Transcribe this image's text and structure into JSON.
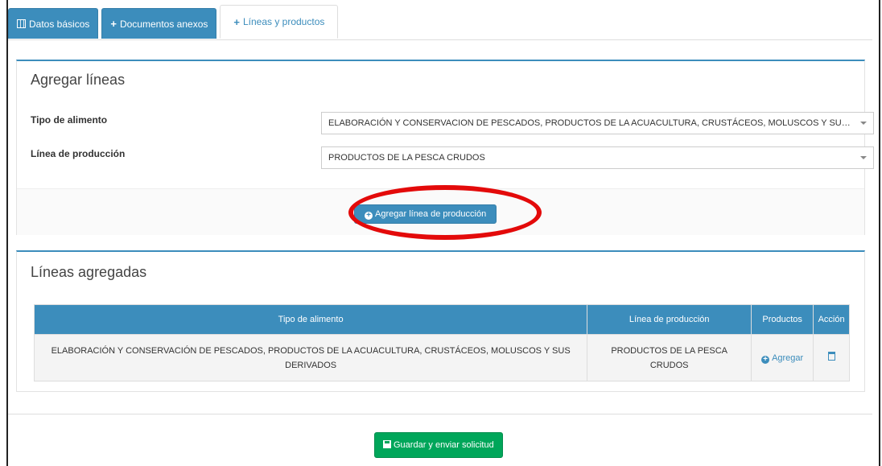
{
  "tabs": [
    {
      "label": "Datos básicos",
      "icon": "calendar-icon",
      "active": false
    },
    {
      "label": "Documentos anexos",
      "icon": "plus-icon",
      "active": false
    },
    {
      "label": "Líneas y productos",
      "icon": "plus-icon",
      "active": true
    }
  ],
  "agregar": {
    "title": "Agregar líneas",
    "tipo_label": "Tipo de alimento",
    "tipo_value": "ELABORACIÓN Y CONSERVACION DE PESCADOS, PRODUCTOS DE LA ACUACULTURA, CRUSTÁCEOS, MOLUSCOS Y SUS DERIVADOS",
    "linea_label": "Línea de producción",
    "linea_value": "PRODUCTOS DE LA PESCA CRUDOS",
    "add_button": "Agregar línea de producción"
  },
  "agregadas": {
    "title": "Líneas agregadas",
    "columns": [
      "Tipo de alimento",
      "Línea de producción",
      "Productos",
      "Acción"
    ],
    "rows": [
      {
        "tipo": "ELABORACIÓN Y CONSERVACIÓN DE PESCADOS, PRODUCTOS DE LA ACUACULTURA, CRUSTÁCEOS, MOLUSCOS Y SUS DERIVADOS",
        "linea": "PRODUCTOS DE LA PESCA CRUDOS",
        "productos": "Agregar",
        "accion_icon": "trash-icon"
      }
    ]
  },
  "footer": {
    "save_button": "Guardar y enviar solicitud"
  },
  "colors": {
    "primary": "#3c8dbc",
    "success": "#00a65a",
    "highlight": "#e30a0a"
  }
}
